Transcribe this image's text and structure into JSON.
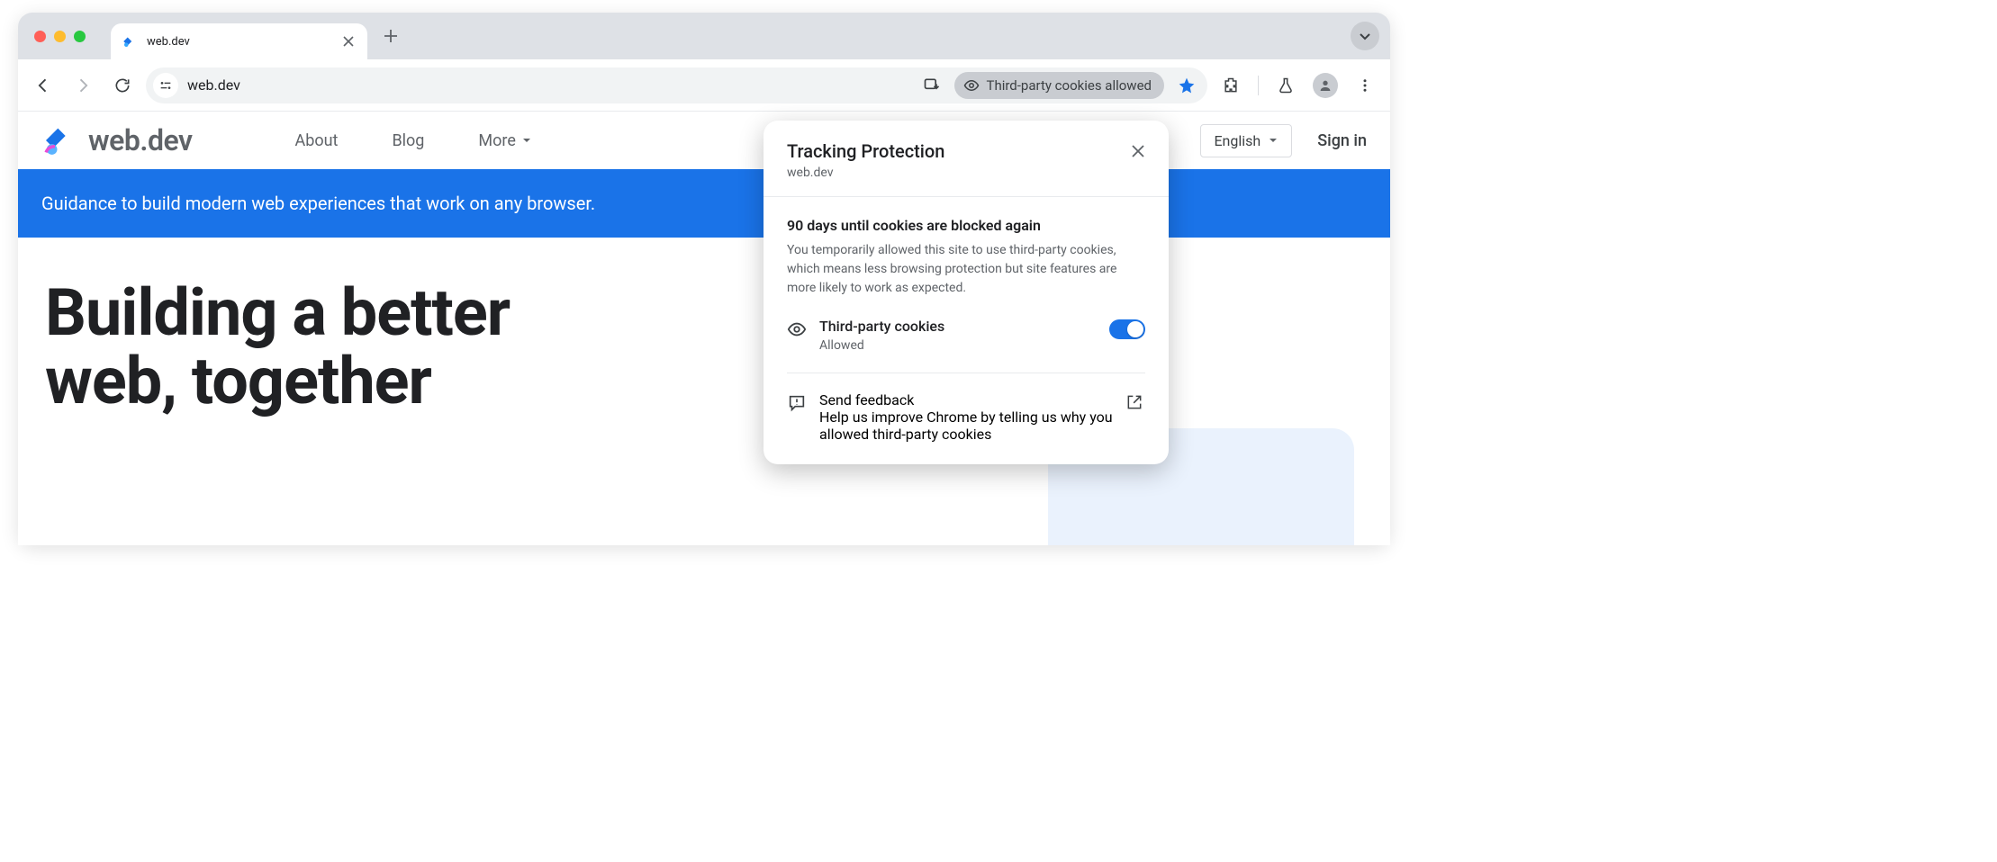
{
  "browser": {
    "tab_title": "web.dev",
    "url": "web.dev",
    "cookie_chip": "Third-party cookies allowed"
  },
  "site": {
    "logo_text": "web.dev",
    "nav": {
      "about": "About",
      "blog": "Blog",
      "more": "More"
    },
    "language": "English",
    "signin": "Sign in",
    "banner": "Guidance to build modern web experiences that work on any browser.",
    "hero_line1": "Building a better",
    "hero_line2": "web, together"
  },
  "popup": {
    "title": "Tracking Protection",
    "site": "web.dev",
    "heading": "90 days until cookies are blocked again",
    "desc": "You temporarily allowed this site to use third-party cookies, which means less browsing protection but site features are more likely to work as expected.",
    "toggle_label": "Third-party cookies",
    "toggle_status": "Allowed",
    "feedback_title": "Send feedback",
    "feedback_desc": "Help us improve Chrome by telling us why you allowed third-party cookies"
  }
}
